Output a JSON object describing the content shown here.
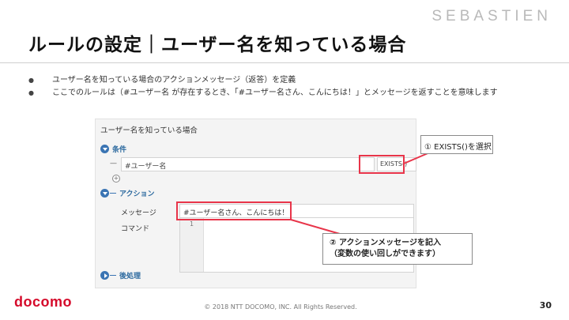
{
  "brand": "SEBASTIEN",
  "title": "ルールの設定｜ユーザー名を知っている場合",
  "bullets": [
    "ユーザー名を知っている場合のアクションメッセージ（返答）を定義",
    "ここでのルールは（#ユーザー名 が存在するとき、「#ユーザー名さん、こんにちは！」とメッセージを返すことを意味します"
  ],
  "panel": {
    "header": "ユーザー名を知っている場合",
    "condition_section": "条件",
    "condition_value": "#ユーザー名",
    "condition_operator": "EXISTS()",
    "add_symbol": "+",
    "action_section": "アクション",
    "message_label": "メッセージ",
    "message_value": "#ユーザー名さん、こんにちは！",
    "command_label": "コマンド",
    "command_line_number": "1",
    "post_section": "後処理"
  },
  "callouts": {
    "c1": "① EXISTS()を選択",
    "c2_line1": "② アクションメッセージを記入",
    "c2_line2": "（変数の使い回しができます）"
  },
  "footer": {
    "logo": "docomo",
    "copyright": "© 2018 NTT DOCOMO, INC. All Rights Reserved.",
    "page": "30"
  },
  "colors": {
    "accent": "#3a74b3",
    "highlight": "#e8354a",
    "logo": "#d50a2a"
  }
}
